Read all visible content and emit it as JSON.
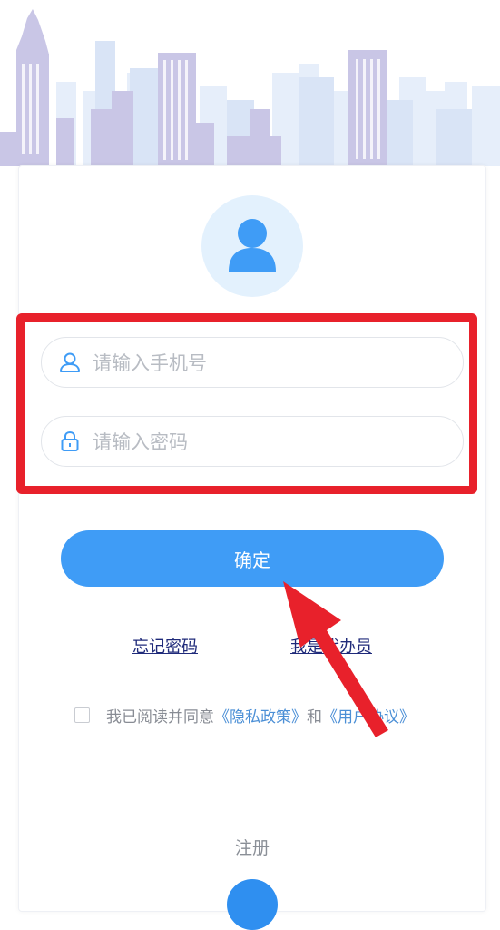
{
  "inputs": {
    "phone_placeholder": "请输入手机号",
    "password_placeholder": "请输入密码"
  },
  "buttons": {
    "confirm_label": "确定"
  },
  "links": {
    "forgot_password": "忘记密码",
    "find_agent": "我是代办员"
  },
  "agreement": {
    "prefix": "我已阅读并同意",
    "privacy_policy": "《隐私政策》",
    "and": "和",
    "user_agreement": "《用户协议》"
  },
  "register": {
    "label": "注册"
  },
  "colors": {
    "primary": "#3f9cf6",
    "highlight_box": "#e8212b",
    "annotation_arrow": "#e8212b",
    "avatar_bg": "#e3f1fd",
    "link_blue": "#4b8fd6"
  },
  "icons": {
    "avatar": "user-avatar-icon",
    "phone_field": "user-icon",
    "password_field": "lock-icon"
  }
}
